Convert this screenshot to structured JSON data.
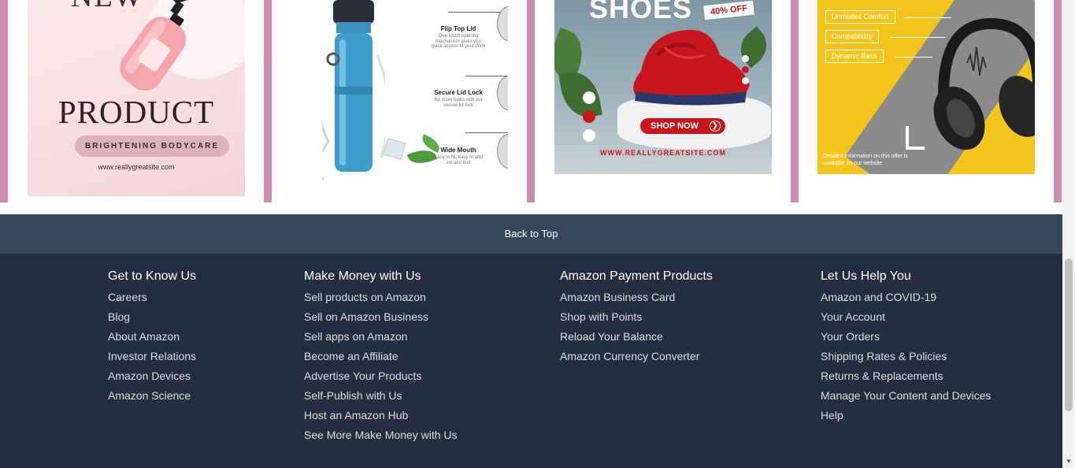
{
  "products": {
    "card1": {
      "top_word": "NEW",
      "word": "PRODUCT",
      "pill": "BRIGHTENING BODYCARE",
      "url": "www.reallygreatsite.com"
    },
    "card2": {
      "features": [
        {
          "title": "Flip Top Lid",
          "desc": "One-touch opening mechanism gives you quick access to your drink"
        },
        {
          "title": "Secure Lid Lock",
          "desc": "No more leaks with our secure lid lock"
        },
        {
          "title": "Wide Mouth",
          "desc": "Easy to fill, easy to add ice and fruit"
        }
      ]
    },
    "card3": {
      "title": "SHOES",
      "discount": "40% OFF",
      "cta": "SHOP NOW",
      "website": "WWW.REALLYGREATSITE.COM"
    },
    "card4": {
      "tags": [
        "Unrivaled Comfort",
        "Compatibility",
        "Dynamic Bass"
      ],
      "note": "Detailed information on this offer is available on our website"
    }
  },
  "back_to_top": "Back to Top",
  "footer": {
    "columns": [
      {
        "heading": "Get to Know Us",
        "links": [
          "Careers",
          "Blog",
          "About Amazon",
          "Investor Relations",
          "Amazon Devices",
          "Amazon Science"
        ]
      },
      {
        "heading": "Make Money with Us",
        "links": [
          "Sell products on Amazon",
          "Sell on Amazon Business",
          "Sell apps on Amazon",
          "Become an Affiliate",
          "Advertise Your Products",
          "Self-Publish with Us",
          "Host an Amazon Hub",
          "See More Make Money with Us"
        ]
      },
      {
        "heading": "Amazon Payment Products",
        "links": [
          "Amazon Business Card",
          "Shop with Points",
          "Reload Your Balance",
          "Amazon Currency Converter"
        ]
      },
      {
        "heading": "Let Us Help You",
        "links": [
          "Amazon and COVID-19",
          "Your Account",
          "Your Orders",
          "Shipping Rates & Policies",
          "Returns & Replacements",
          "Manage Your Content and Devices",
          "Help"
        ]
      }
    ]
  },
  "colors": {
    "back_to_top_bg": "#37475a",
    "footer_bg": "#232f3e",
    "card_divider": "#cc8cb2"
  }
}
